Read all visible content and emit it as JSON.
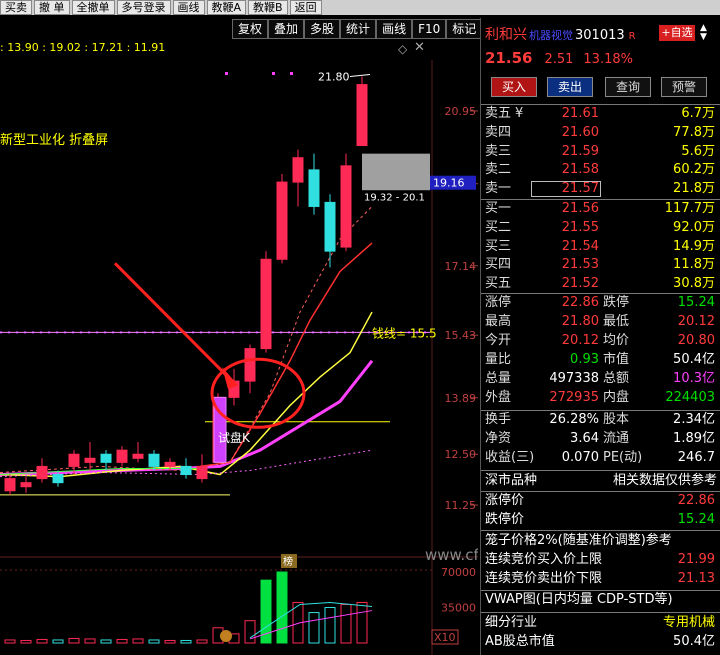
{
  "topbar": {
    "items": [
      "买卖",
      "撤 单",
      "全撤单",
      "多号登录",
      "画线",
      "教鞭A",
      "教鞭B",
      "返回"
    ]
  },
  "toolbar": {
    "items": [
      "复权",
      "叠加",
      "多股",
      "统计",
      "画线",
      "F10",
      "标记",
      "返回"
    ]
  },
  "ma_values": [
    ": 13.90",
    ": 19.02",
    ": 17.21",
    ": 11.91"
  ],
  "chart": {
    "note": "新型工业化 折叠屏",
    "high_label": "21.80",
    "range_label": "19.32 - 20.1",
    "price_tag": "19.16",
    "neckline_label": "钱线= 15.5",
    "trial_label": "试盘K",
    "rank_badge": "榜",
    "watermark": "www.cfgjy.com",
    "ax_labels": [
      "20.95",
      "19.16",
      "17.14",
      "15.43",
      "13.89",
      "12.50",
      "11.25"
    ],
    "vol_labels": [
      "70000",
      "35000",
      "X10"
    ]
  },
  "chart_data": {
    "type": "candlestick",
    "price_axis_ticks": [
      20.95,
      19.16,
      17.14,
      15.43,
      13.89,
      12.5,
      11.25
    ],
    "volume_axis_ticks": [
      70000,
      35000
    ],
    "candles": [
      {
        "o": 11.6,
        "c": 11.9,
        "h": 12.0,
        "l": 11.5
      },
      {
        "o": 11.7,
        "c": 11.8,
        "h": 11.95,
        "l": 11.55
      },
      {
        "o": 11.9,
        "c": 12.2,
        "h": 12.4,
        "l": 11.8
      },
      {
        "o": 12.0,
        "c": 11.8,
        "h": 12.1,
        "l": 11.7
      },
      {
        "o": 12.2,
        "c": 12.5,
        "h": 12.6,
        "l": 12.0
      },
      {
        "o": 12.3,
        "c": 12.4,
        "h": 12.8,
        "l": 12.1
      },
      {
        "o": 12.5,
        "c": 12.3,
        "h": 12.6,
        "l": 12.1
      },
      {
        "o": 12.3,
        "c": 12.6,
        "h": 12.7,
        "l": 12.2
      },
      {
        "o": 12.4,
        "c": 12.5,
        "h": 12.8,
        "l": 12.3
      },
      {
        "o": 12.5,
        "c": 12.2,
        "h": 12.6,
        "l": 12.1
      },
      {
        "o": 12.2,
        "c": 12.3,
        "h": 12.4,
        "l": 12.1
      },
      {
        "o": 12.2,
        "c": 12.0,
        "h": 12.4,
        "l": 11.9
      },
      {
        "o": 11.9,
        "c": 12.2,
        "h": 12.5,
        "l": 11.8
      },
      {
        "o": 12.3,
        "c": 13.9,
        "h": 14.0,
        "l": 12.3
      },
      {
        "o": 13.9,
        "c": 14.3,
        "h": 14.6,
        "l": 13.7
      },
      {
        "o": 14.3,
        "c": 15.1,
        "h": 15.2,
        "l": 14.0
      },
      {
        "o": 15.1,
        "c": 17.3,
        "h": 17.5,
        "l": 15.0
      },
      {
        "o": 17.3,
        "c": 19.2,
        "h": 19.4,
        "l": 17.2
      },
      {
        "o": 19.2,
        "c": 19.8,
        "h": 20.0,
        "l": 18.6
      },
      {
        "o": 19.5,
        "c": 18.6,
        "h": 19.9,
        "l": 18.4
      },
      {
        "o": 18.7,
        "c": 17.5,
        "h": 18.9,
        "l": 17.1
      },
      {
        "o": 17.6,
        "c": 19.6,
        "h": 19.9,
        "l": 17.5
      },
      {
        "o": 20.1,
        "c": 21.6,
        "h": 21.8,
        "l": 20.1
      }
    ],
    "volumes": [
      3000,
      2500,
      3500,
      3000,
      4500,
      4000,
      3000,
      3500,
      4000,
      3000,
      2500,
      2500,
      3000,
      15000,
      9000,
      22000,
      62000,
      70000,
      40000,
      30000,
      35000,
      38000,
      40000
    ]
  },
  "panel": {
    "name": "利和兴",
    "tag": "机器视觉",
    "code": "301013",
    "r_mark": "R",
    "add_label": "+自选",
    "price": "21.56",
    "change": "2.51",
    "pct": "13.18%",
    "buy_label": "买入",
    "sell_label": "卖出",
    "query_label": "查询",
    "alert_label": "预警",
    "asks": [
      {
        "label": "卖五",
        "flag": "¥",
        "price": "21.61",
        "qty": "6.7万"
      },
      {
        "label": "卖四",
        "flag": "",
        "price": "21.60",
        "qty": "77.8万"
      },
      {
        "label": "卖三",
        "flag": "",
        "price": "21.59",
        "qty": "5.6万"
      },
      {
        "label": "卖二",
        "flag": "",
        "price": "21.58",
        "qty": "60.2万"
      },
      {
        "label": "卖一",
        "flag": "",
        "price": "21.57",
        "qty": "21.8万"
      }
    ],
    "bids": [
      {
        "label": "买一",
        "price": "21.56",
        "qty": "117.7万"
      },
      {
        "label": "买二",
        "price": "21.55",
        "qty": "92.0万"
      },
      {
        "label": "买三",
        "price": "21.54",
        "qty": "14.9万"
      },
      {
        "label": "买四",
        "price": "21.53",
        "qty": "11.8万"
      },
      {
        "label": "买五",
        "price": "21.52",
        "qty": "30.8万"
      }
    ],
    "stats": [
      {
        "l1": "涨停",
        "v1": "22.86",
        "c1": "red",
        "l2": "跌停",
        "v2": "15.24",
        "c2": "green"
      },
      {
        "l1": "最高",
        "v1": "21.80",
        "c1": "red",
        "l2": "最低",
        "v2": "20.12",
        "c2": "red"
      },
      {
        "l1": "今开",
        "v1": "20.12",
        "c1": "red",
        "l2": "均价",
        "v2": "20.80",
        "c2": "red"
      },
      {
        "l1": "量比",
        "v1": "0.93",
        "c1": "green",
        "l2": "市值",
        "v2": "50.4亿",
        "c2": "white"
      },
      {
        "l1": "总量",
        "v1": "497338",
        "c1": "white",
        "l2": "总额",
        "v2": "10.3亿",
        "c2": "mag"
      },
      {
        "l1": "外盘",
        "v1": "272935",
        "c1": "red",
        "l2": "内盘",
        "v2": "224403",
        "c2": "green"
      }
    ],
    "stats2": [
      {
        "l1": "换手",
        "v1": "26.28%",
        "c1": "white",
        "l2": "股本",
        "v2": "2.34亿",
        "c2": "white"
      },
      {
        "l1": "净资",
        "v1": "3.64",
        "c1": "white",
        "l2": "流通",
        "v2": "1.89亿",
        "c2": "white"
      },
      {
        "l1": "收益(三)",
        "v1": "0.070",
        "c1": "white",
        "l2": "PE(动)",
        "v2": "246.7",
        "c2": "white"
      }
    ],
    "market": "深市品种",
    "market_note": "相关数据仅供参考",
    "limit_up_label": "涨停价",
    "limit_up": "22.86",
    "limit_down_label": "跌停价",
    "limit_down": "15.24",
    "cage_label": "笼子价格2%(随基准价调整)参考",
    "bid_cap_label": "连续竞价买入价上限",
    "bid_cap": "21.99",
    "ask_floor_label": "连续竞价卖出价下限",
    "ask_floor": "21.13",
    "vwap_label": "VWAP图(日内均量 CDP-STD等)",
    "industry_label": "细分行业",
    "industry": "专用机械",
    "ab_label": "AB股总市值",
    "ab_value": "50.4亿"
  }
}
